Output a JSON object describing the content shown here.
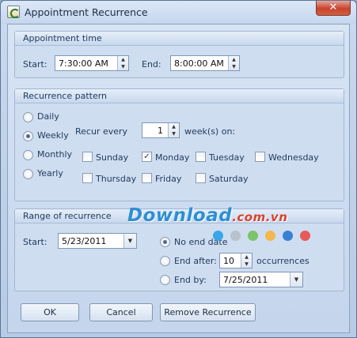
{
  "window": {
    "title": "Appointment Recurrence",
    "close_glyph": "✕"
  },
  "appointment_time": {
    "title": "Appointment time",
    "start_label": "Start:",
    "start_value": "7:30:00 AM",
    "end_label": "End:",
    "end_value": "8:00:00 AM"
  },
  "recurrence_pattern": {
    "title": "Recurrence pattern",
    "options": [
      {
        "label": "Daily",
        "selected": false
      },
      {
        "label": "Weekly",
        "selected": true
      },
      {
        "label": "Monthly",
        "selected": false
      },
      {
        "label": "Yearly",
        "selected": false
      }
    ],
    "recur_every_label": "Recur every",
    "recur_every_value": "1",
    "weeks_on_label": "week(s) on:",
    "days": [
      {
        "label": "Sunday",
        "checked": false
      },
      {
        "label": "Monday",
        "checked": true
      },
      {
        "label": "Tuesday",
        "checked": false
      },
      {
        "label": "Wednesday",
        "checked": false
      },
      {
        "label": "Thursday",
        "checked": false
      },
      {
        "label": "Friday",
        "checked": false
      },
      {
        "label": "Saturday",
        "checked": false
      }
    ]
  },
  "range": {
    "title": "Range of recurrence",
    "start_label": "Start:",
    "start_value": "5/23/2011",
    "no_end_label": "No end date",
    "end_after_label": "End after:",
    "end_after_value": "10",
    "occurrences_label": "occurrences",
    "end_by_label": "End by:",
    "end_by_value": "7/25/2011",
    "selected": "no_end"
  },
  "buttons": {
    "ok": "OK",
    "cancel": "Cancel",
    "remove": "Remove Recurrence"
  },
  "watermark": {
    "text": "Download",
    "suffix": ".com.vn",
    "dot_colors": [
      "#3aa6e8",
      "#b9c1cc",
      "#7cc36b",
      "#f2b84b",
      "#3a7fd4",
      "#e65a5a"
    ]
  },
  "colors": {
    "title_text": "#1e395b",
    "close_button": "#c7432e"
  }
}
